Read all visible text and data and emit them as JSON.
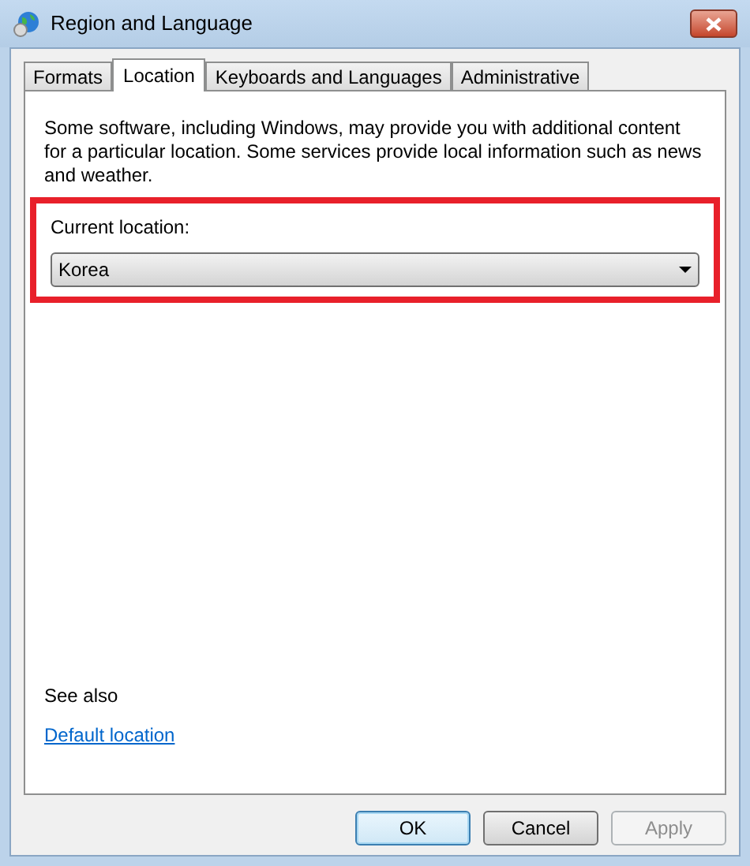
{
  "window": {
    "title": "Region and Language"
  },
  "tabs": [
    {
      "label": "Formats",
      "selected": false
    },
    {
      "label": "Location",
      "selected": true
    },
    {
      "label": "Keyboards and Languages",
      "selected": false
    },
    {
      "label": "Administrative",
      "selected": false
    }
  ],
  "description": "Some software, including Windows, may provide you with additional content for a particular location. Some services provide local information such as news and weather.",
  "current_location": {
    "label": "Current location:",
    "value": "Korea",
    "highlighted": true
  },
  "see_also": {
    "heading": "See also",
    "link": "Default location"
  },
  "buttons": [
    {
      "label": "OK",
      "default": true,
      "disabled": false
    },
    {
      "label": "Cancel",
      "default": false,
      "disabled": false
    },
    {
      "label": "Apply",
      "default": false,
      "disabled": true
    }
  ]
}
